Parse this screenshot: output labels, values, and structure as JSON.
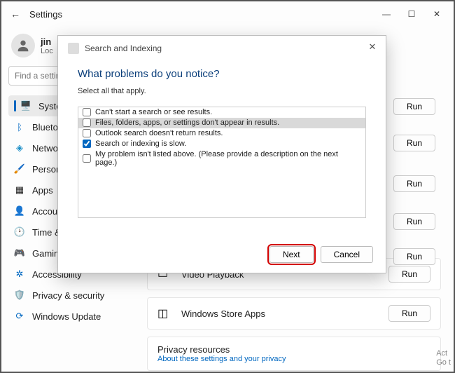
{
  "window": {
    "title": "Settings",
    "min": "—",
    "max": "☐",
    "close": "✕"
  },
  "user": {
    "name": "jin",
    "sub": "Loc"
  },
  "search_placeholder": "Find a setting",
  "nav": [
    {
      "label": "System",
      "icon": "monitor"
    },
    {
      "label": "Bluetooth",
      "icon": "bluetooth"
    },
    {
      "label": "Network",
      "icon": "wifi"
    },
    {
      "label": "Personalization",
      "icon": "brush"
    },
    {
      "label": "Apps",
      "icon": "apps"
    },
    {
      "label": "Accounts",
      "icon": "person"
    },
    {
      "label": "Time & language",
      "icon": "clock"
    },
    {
      "label": "Gaming",
      "icon": "game"
    },
    {
      "label": "Accessibility",
      "icon": "access"
    },
    {
      "label": "Privacy & security",
      "icon": "shield"
    },
    {
      "label": "Windows Update",
      "icon": "update"
    }
  ],
  "nav_visible": [
    "System",
    "Bluetoo",
    "Networ",
    "Persona",
    "Apps",
    "Accoun",
    "Time &",
    "Gaming",
    "Accessibility",
    "Privacy & security",
    "Windows Update"
  ],
  "cards": [
    {
      "title": "Video Playback",
      "run": "Run"
    },
    {
      "title": "Windows Store Apps",
      "run": "Run"
    }
  ],
  "run_label": "Run",
  "privacy": {
    "title": "Privacy resources",
    "sub": "About these settings and your privacy"
  },
  "watermark": {
    "l1": "Act",
    "l2": "Go t"
  },
  "dialog": {
    "title": "Search and Indexing",
    "question": "What problems do you notice?",
    "instruction": "Select all that apply.",
    "options": [
      {
        "label": "Can't start a search or see results.",
        "checked": false
      },
      {
        "label": "Files, folders, apps, or settings don't appear in results.",
        "checked": false,
        "highlight": true
      },
      {
        "label": "Outlook search doesn't return results.",
        "checked": false
      },
      {
        "label": "Search or indexing is slow.",
        "checked": true
      },
      {
        "label": "My problem isn't listed above. (Please provide a description on the next page.)",
        "checked": false
      }
    ],
    "next": "Next",
    "cancel": "Cancel"
  }
}
